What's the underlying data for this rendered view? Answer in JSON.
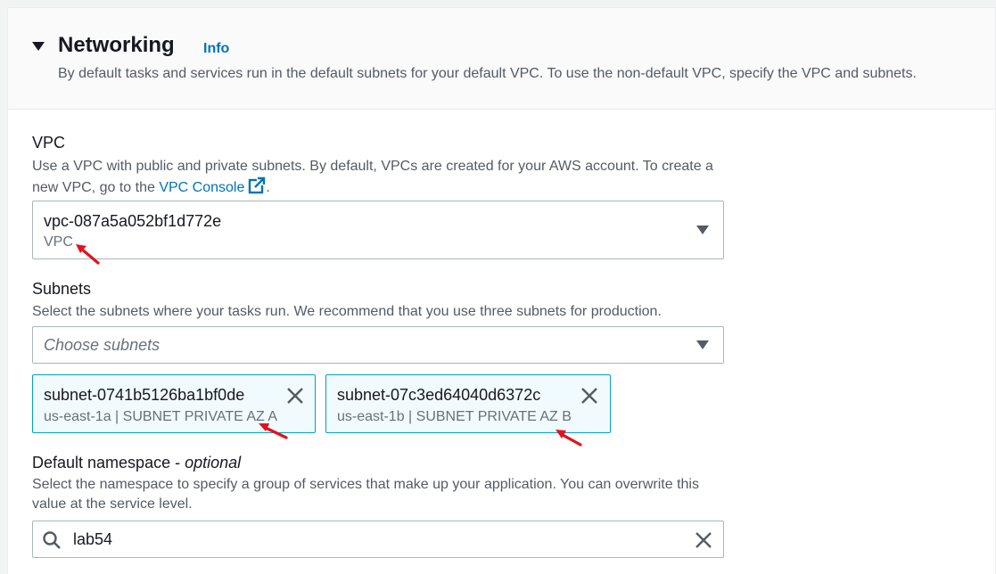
{
  "header": {
    "title": "Networking",
    "info_link": "Info",
    "description": "By default tasks and services run in the default subnets for your default VPC. To use the non-default VPC, specify the VPC and subnets."
  },
  "vpc": {
    "label": "VPC",
    "description_prefix": "Use a VPC with public and private subnets. By default, VPCs are created for your AWS account. To create a new VPC, go to the",
    "console_link": "VPC Console",
    "description_suffix": ".",
    "selected_value": "vpc-087a5a052bf1d772e",
    "selected_label": "VPC"
  },
  "subnets": {
    "label": "Subnets",
    "description": "Select the subnets where your tasks run. We recommend that you use three subnets for production.",
    "placeholder": "Choose subnets",
    "tokens": [
      {
        "id": "subnet-0741b5126ba1bf0de",
        "detail": "us-east-1a | SUBNET PRIVATE AZ A"
      },
      {
        "id": "subnet-07c3ed64040d6372c",
        "detail": "us-east-1b | SUBNET PRIVATE AZ B"
      }
    ]
  },
  "namespace": {
    "label_main": "Default namespace -",
    "label_optional": "optional",
    "description": "Select the namespace to specify a group of services that make up your application. You can overwrite this value at the service level.",
    "value": "lab54"
  },
  "colors": {
    "link": "#0073bb",
    "token_border": "#00a1c9",
    "token_bg": "#f1faff",
    "annotation_arrow": "#e3121b"
  }
}
